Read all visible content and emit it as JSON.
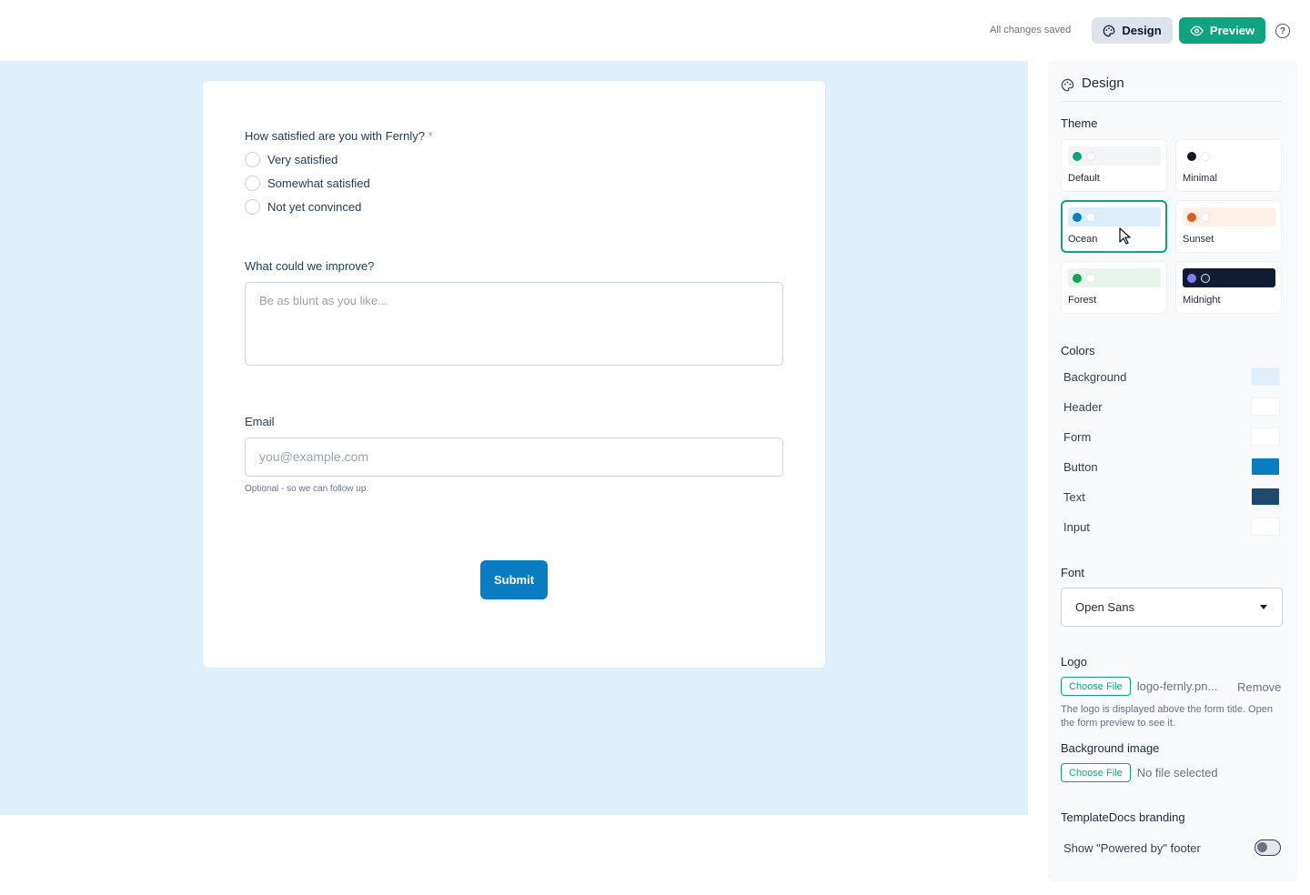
{
  "topbar": {
    "status": "All changes saved",
    "design_label": "Design",
    "preview_label": "Preview",
    "help_label": "?"
  },
  "form": {
    "question1": {
      "label": "How satisfied are you with Fernly?",
      "required_mark": "*",
      "options": [
        "Very satisfied",
        "Somewhat satisfied",
        "Not yet convinced"
      ]
    },
    "question2": {
      "label": "What could we improve?",
      "placeholder": "Be as blunt as you like..."
    },
    "email": {
      "label": "Email",
      "placeholder": "you@example.com",
      "hint": "Optional - so we can follow up."
    },
    "submit_label": "Submit"
  },
  "sidebar": {
    "title": "Design",
    "theme_heading": "Theme",
    "themes": [
      {
        "name": "Default",
        "swatch": "#f3f4f6",
        "dot1": "#10a37f",
        "dot2": "#ffffff",
        "selected": false
      },
      {
        "name": "Minimal",
        "swatch": "#ffffff",
        "dot1": "#111827",
        "dot2": "#ffffff",
        "selected": false
      },
      {
        "name": "Ocean",
        "swatch": "#dbeefb",
        "dot1": "#0a7cc2",
        "dot2": "#ffffff",
        "selected": true
      },
      {
        "name": "Sunset",
        "swatch": "#fdf1e7",
        "dot1": "#e2571c",
        "dot2": "#ffffff",
        "selected": false
      },
      {
        "name": "Forest",
        "swatch": "#e7f5ec",
        "dot1": "#16a34a",
        "dot2": "#ffffff",
        "selected": false
      },
      {
        "name": "Midnight",
        "swatch": "#111a33",
        "dot1": "#7c83f0",
        "dot2": "#1e2744",
        "selected": false
      }
    ],
    "colors_heading": "Colors",
    "colors": [
      {
        "label": "Background",
        "value": "#e0f0fb"
      },
      {
        "label": "Header",
        "value": "#ffffff"
      },
      {
        "label": "Form",
        "value": "#ffffff"
      },
      {
        "label": "Button",
        "value": "#0a7cc2"
      },
      {
        "label": "Text",
        "value": "#1e4a6e"
      },
      {
        "label": "Input",
        "value": "#ffffff"
      }
    ],
    "font_heading": "Font",
    "font_value": "Open Sans",
    "logo_heading": "Logo",
    "logo_choose": "Choose File",
    "logo_filename": "logo-fernly.pn...",
    "logo_remove": "Remove",
    "logo_desc": "The logo is displayed above the form title. Open the form preview to see it.",
    "bgimage_heading": "Background image",
    "bgimage_choose": "Choose File",
    "bgimage_filename": "No file selected",
    "branding_heading": "TemplateDocs branding",
    "branding_toggle_label": "Show \"Powered by\" footer",
    "branding_toggle_on": false
  }
}
